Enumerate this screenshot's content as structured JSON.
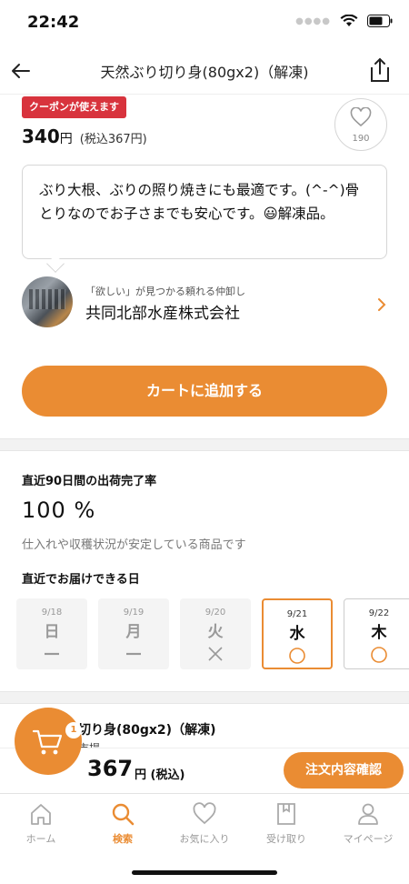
{
  "status": {
    "time": "22:42"
  },
  "nav": {
    "title": "天然ぶり切り身(80gx2)（解凍)"
  },
  "product": {
    "coupon_label": "クーポンが使えます",
    "price": "340",
    "price_unit": "円",
    "price_tax": "(税込367円)",
    "favorite_count": "190",
    "description": "ぶり大根、ぶりの照り焼きにも最適です。(^-^)骨とりなのでお子さまでも安心です。😃解凍品。"
  },
  "seller": {
    "tagline": "「欲しい」が見つかる頼れる仲卸し",
    "name": "共同北部水産株式会社"
  },
  "actions": {
    "add_to_cart": "カートに追加する"
  },
  "shipping": {
    "completion_label": "直近90日間の出荷完了率",
    "completion_rate": "100 %",
    "completion_desc": "仕入れや収穫状況が安定している商品です",
    "delivery_label": "直近でお届けできる日",
    "days": [
      {
        "date": "9/18",
        "weekday": "日",
        "mark": "—"
      },
      {
        "date": "9/19",
        "weekday": "月",
        "mark": "—"
      },
      {
        "date": "9/20",
        "weekday": "火",
        "mark": "×"
      },
      {
        "date": "9/21",
        "weekday": "水",
        "mark": "◯"
      },
      {
        "date": "9/22",
        "weekday": "木",
        "mark": "◯"
      }
    ]
  },
  "cart_item": {
    "title": "切り身(80gx2)（解凍)",
    "sub": "市場"
  },
  "checkout": {
    "total": "367",
    "total_suffix": "円 (税込)",
    "button": "注文内容確認",
    "cart_badge": "1"
  },
  "tabbar": {
    "items": [
      {
        "label": "ホーム",
        "icon": "home-icon"
      },
      {
        "label": "検索",
        "icon": "search-icon"
      },
      {
        "label": "お気に入り",
        "icon": "heart-icon"
      },
      {
        "label": "受け取り",
        "icon": "receive-box-icon"
      },
      {
        "label": "マイページ",
        "icon": "person-icon"
      }
    ],
    "active": "検索"
  },
  "colors": {
    "accent": "#ea8c33",
    "coupon": "#d8333d"
  }
}
